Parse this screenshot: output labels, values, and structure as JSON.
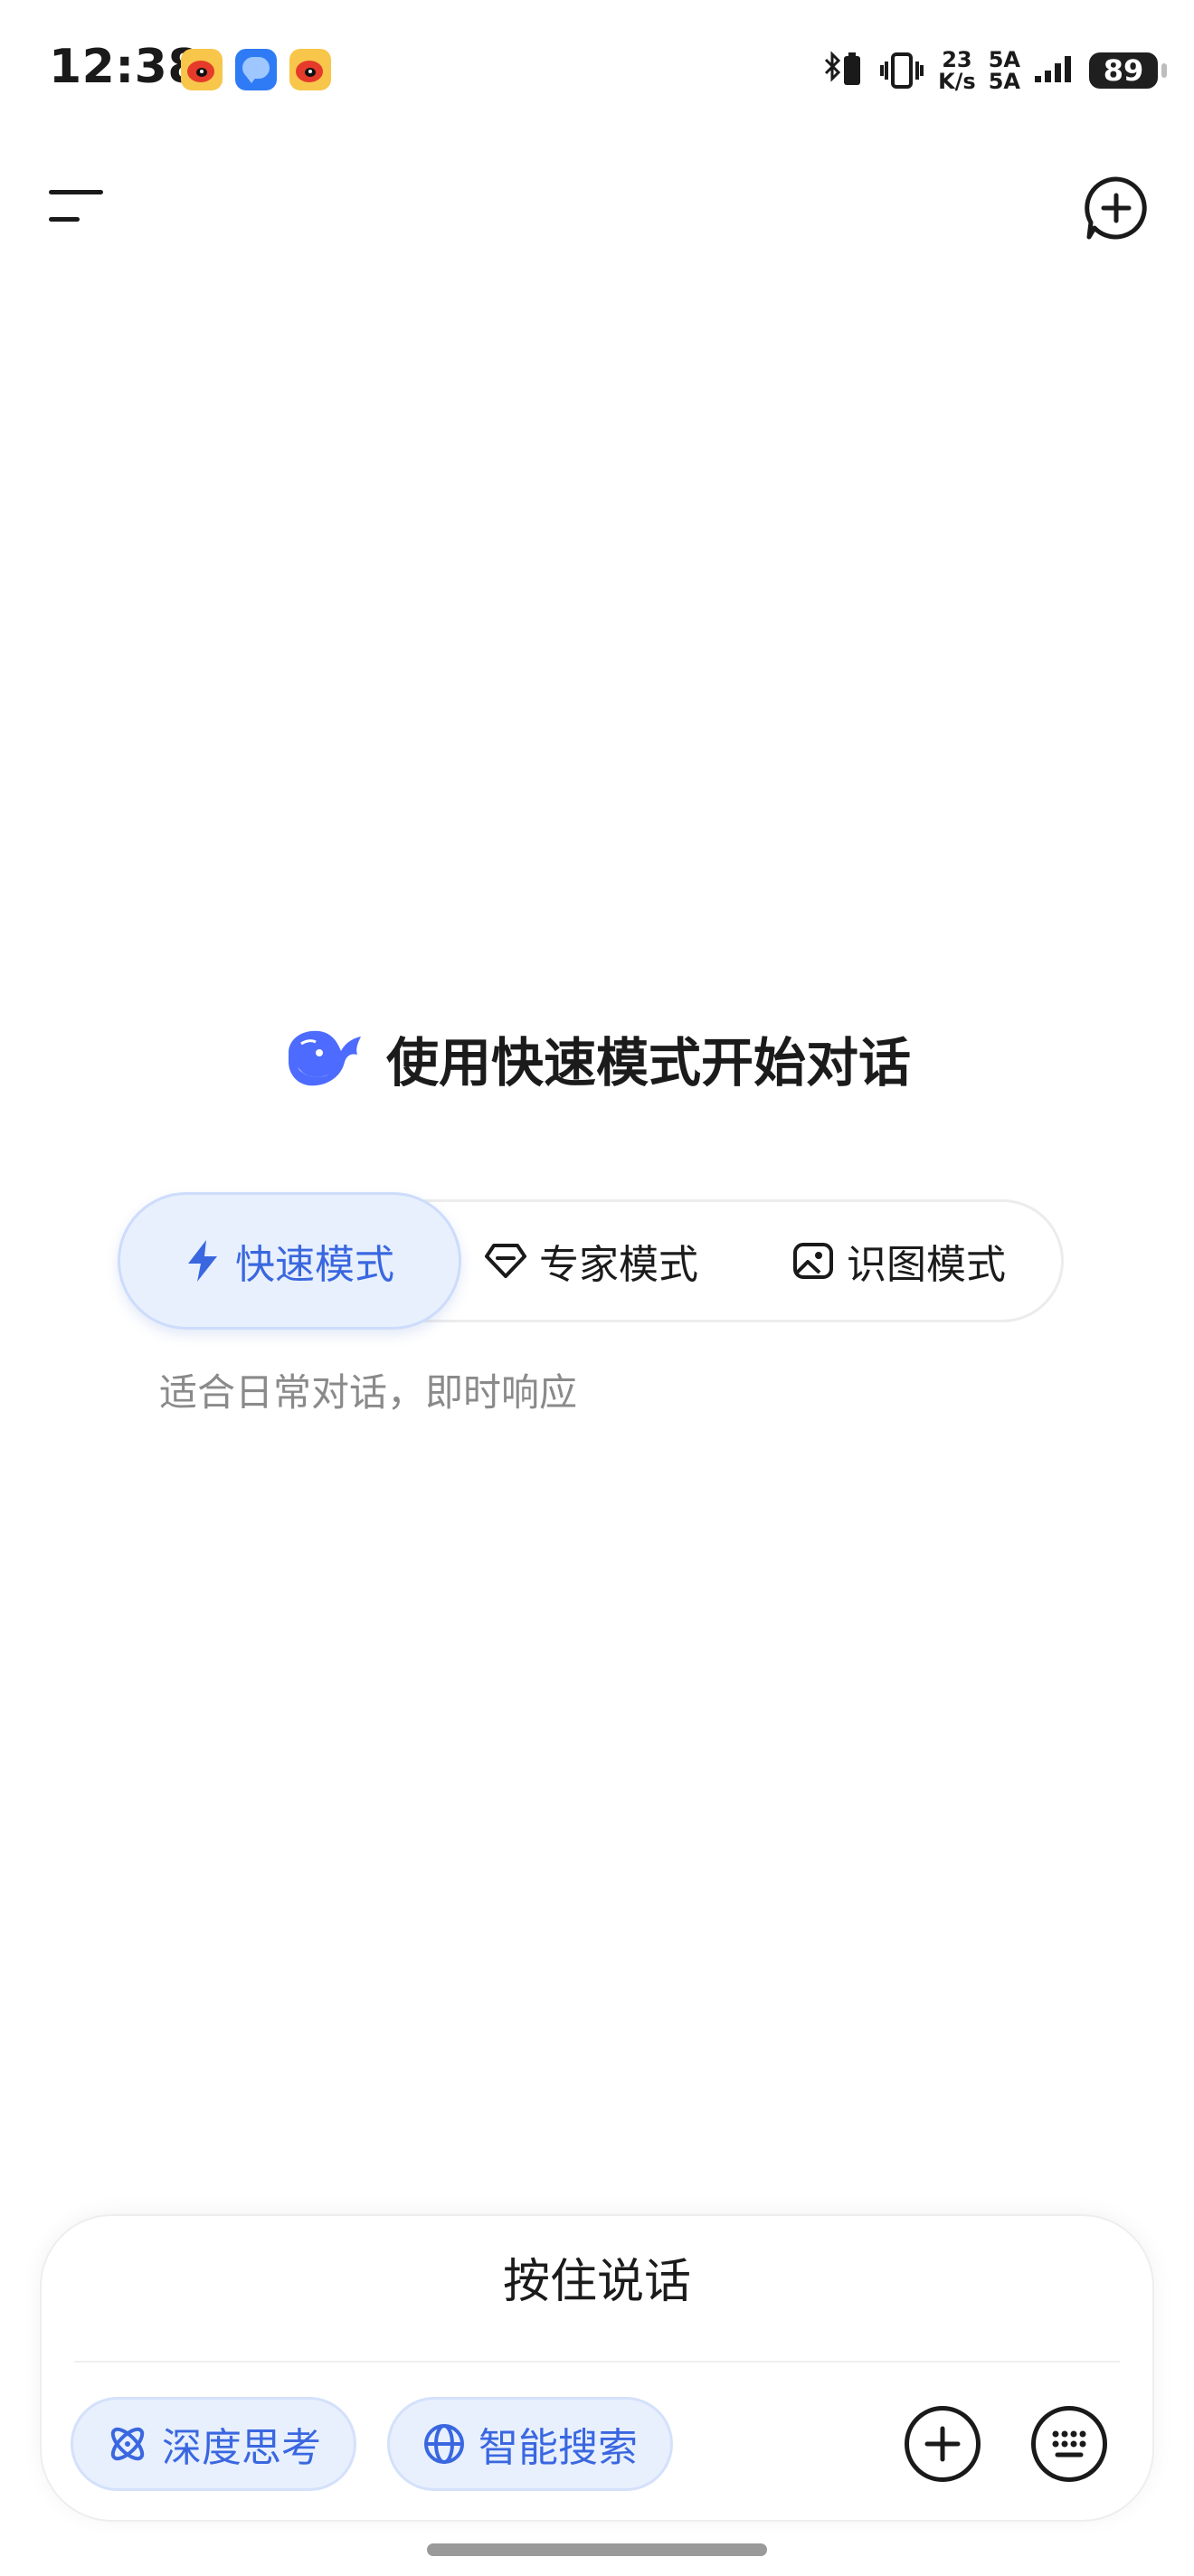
{
  "status_bar": {
    "time": "12:38",
    "notification_icons": [
      "weibo-icon",
      "message-icon",
      "weibo-icon"
    ],
    "net_speed_value": "23",
    "net_speed_unit": "K/s",
    "signal_1": "5A",
    "signal_2": "5A",
    "battery": "89"
  },
  "header": {
    "menu_icon": "menu-icon",
    "new_chat_icon": "new-chat-icon"
  },
  "hero": {
    "logo": "whale-logo-icon",
    "title": "使用快速模式开始对话"
  },
  "modes": {
    "items": [
      {
        "label": "快速模式",
        "icon": "lightning-icon",
        "selected": true
      },
      {
        "label": "专家模式",
        "icon": "diamond-icon",
        "selected": false
      },
      {
        "label": "识图模式",
        "icon": "image-icon",
        "selected": false
      }
    ],
    "description": "适合日常对话，即时响应"
  },
  "composer": {
    "hold_to_talk": "按住说话",
    "chips": [
      {
        "label": "深度思考",
        "icon": "atom-icon"
      },
      {
        "label": "智能搜索",
        "icon": "globe-icon"
      }
    ],
    "add_icon": "plus-circle-icon",
    "keyboard_icon": "keyboard-icon"
  },
  "colors": {
    "accent": "#3a67e0",
    "accent_bg": "#e8f0fe",
    "text": "#1b1b1b",
    "muted": "#8a8a8a"
  }
}
